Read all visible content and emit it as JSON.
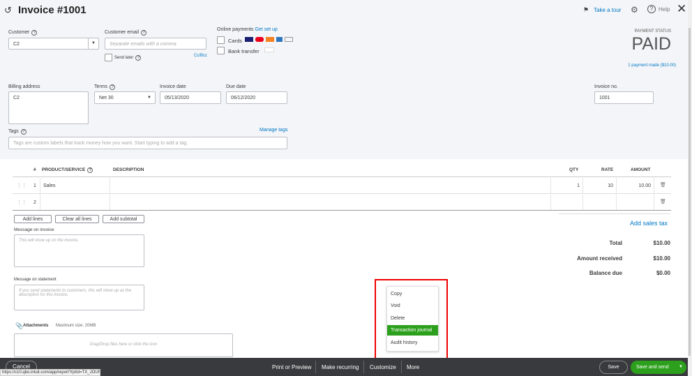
{
  "header": {
    "title": "Invoice #1001",
    "take_tour": "Take a tour",
    "help": "Help"
  },
  "customer": {
    "label": "Customer",
    "value": "C2"
  },
  "email": {
    "label": "Customer email",
    "placeholder": "Separate emails with a comma",
    "send_later": "Send later",
    "cc_bcc": "Cc/Bcc"
  },
  "online_payments": {
    "label": "Online payments",
    "setup": "Get set up",
    "cards": "Cards",
    "bank": "Bank transfer"
  },
  "payment_status": {
    "label": "PAYMENT STATUS",
    "value": "PAID",
    "payments_link": "1 payment made ($10.00)"
  },
  "billing": {
    "label": "Billing address",
    "value": "C2"
  },
  "terms": {
    "label": "Terms",
    "value": "Net 30"
  },
  "invoice_date": {
    "label": "Invoice date",
    "value": "05/13/2020"
  },
  "due_date": {
    "label": "Due date",
    "value": "06/12/2020"
  },
  "invoice_no": {
    "label": "Invoice no.",
    "value": "1001"
  },
  "tags": {
    "label": "Tags",
    "manage": "Manage tags",
    "placeholder": "Tags are custom labels that track money how you want. Start typing to add a tag."
  },
  "table": {
    "headers": {
      "num": "#",
      "product": "PRODUCT/SERVICE",
      "description": "DESCRIPTION",
      "qty": "QTY",
      "rate": "RATE",
      "amount": "AMOUNT"
    },
    "rows": [
      {
        "num": "1",
        "product": "Sales",
        "description": "",
        "qty": "1",
        "rate": "10",
        "amount": "10.00"
      },
      {
        "num": "2",
        "product": "",
        "description": "",
        "qty": "",
        "rate": "",
        "amount": ""
      }
    ]
  },
  "line_buttons": {
    "add_lines": "Add lines",
    "clear_all": "Clear all lines",
    "add_subtotal": "Add subtotal"
  },
  "add_sales_tax": "Add sales tax",
  "totals": {
    "total_label": "Total",
    "total": "$10.00",
    "received_label": "Amount received",
    "received": "$10.00",
    "balance_label": "Balance due",
    "balance": "$0.00"
  },
  "message_invoice": {
    "label": "Message on invoice",
    "placeholder": "This will show up on the invoice."
  },
  "message_statement": {
    "label": "Message on statement",
    "placeholder": "If you send statements to customers, this will show up as the description for this invoice."
  },
  "attachments": {
    "label": "Attachments",
    "max": "Maximum size: 20MB",
    "drop": "Drag/Drop files here or click the icon"
  },
  "more_menu": {
    "items": [
      "Copy",
      "Void",
      "Delete",
      "Transaction journal",
      "Audit history"
    ],
    "highlight_color": "#2ca01c"
  },
  "footer": {
    "cancel": "Cancel",
    "print": "Print or Preview",
    "recurring": "Make recurring",
    "customize": "Customize",
    "more": "More",
    "save": "Save",
    "save_send": "Save and send"
  },
  "status_url": "https://c10.qbo.intuit.com/app/report?rptId=TX_JOURNAL&date_macro=all&txnId=1"
}
